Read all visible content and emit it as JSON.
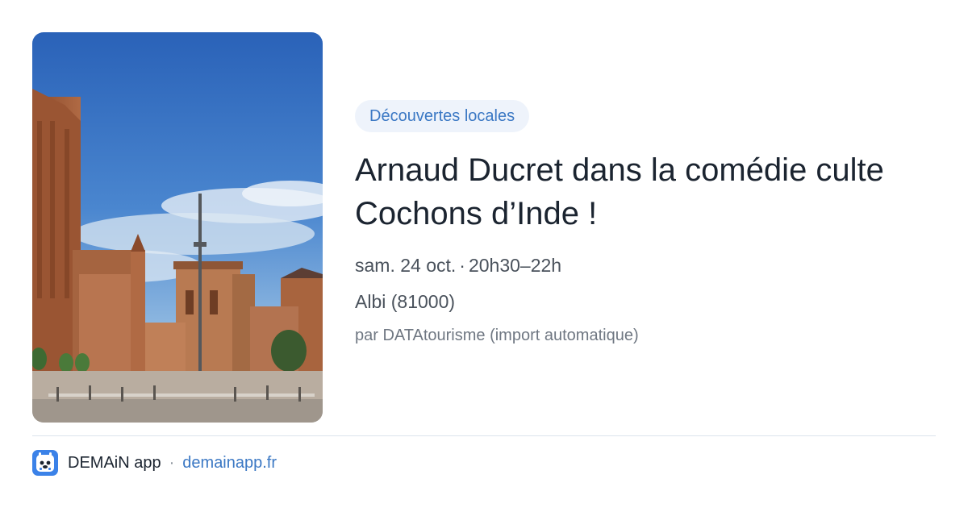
{
  "event": {
    "category": "Découvertes locales",
    "title": "Arnaud Ducret dans la comédie culte Cochons d’Inde !",
    "date": "sam. 24 oct.",
    "date_separator": "·",
    "time": "20h30–22h",
    "location": "Albi (81000)",
    "source": "par DATAtourisme (import automatique)",
    "image": "albi-cathedral-square-photo"
  },
  "footer": {
    "app_icon": "demain-app-logo-icon",
    "app_name": "DEMAiN app",
    "separator": "·",
    "url": "demainapp.fr"
  },
  "colors": {
    "accent": "#3b78c4",
    "tag_bg": "#eef3fb",
    "title": "#1b2430",
    "meta": "#4a525c",
    "divider": "#dbe4ec"
  }
}
